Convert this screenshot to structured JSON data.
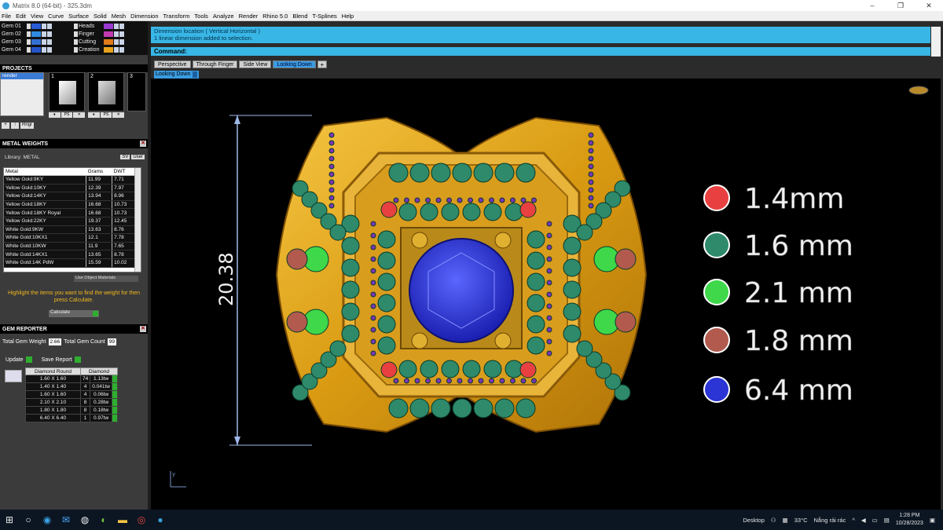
{
  "window": {
    "title": "Matrix 8.0 (64-bit) - 325.3dm",
    "min": "–",
    "max": "❐",
    "close": "✕"
  },
  "menu": [
    "File",
    "Edit",
    "View",
    "Curve",
    "Surface",
    "Solid",
    "Mesh",
    "Dimension",
    "Transform",
    "Tools",
    "Analyze",
    "Render",
    "Rhino 5.0",
    "Blend",
    "T-Splines",
    "Help"
  ],
  "layers": {
    "left": [
      {
        "name": "Gem 01",
        "color": "#2a5bd6"
      },
      {
        "name": "Gem 02",
        "color": "#2f8ae0"
      },
      {
        "name": "Gem 03",
        "color": "#3470d4"
      },
      {
        "name": "Gem 04",
        "color": "#2454c8"
      }
    ],
    "right": [
      {
        "name": "Heads",
        "color": "#9b3ad0"
      },
      {
        "name": "Finger",
        "color": "#c23ab0"
      },
      {
        "name": "Cutting",
        "color": "#e07a1a"
      },
      {
        "name": "Creation",
        "color": "#e8a21c"
      }
    ]
  },
  "projects": {
    "title": "PROJECTS",
    "item": "render",
    "thumbs": [
      "1",
      "2",
      "3"
    ],
    "tool_ring": "Rngr"
  },
  "metal": {
    "title": "METAL WEIGHTS",
    "library": "Library: METAL",
    "btn_sv": "SV",
    "btn_user": "User",
    "headers": [
      "Metal",
      "Grams",
      "DWT"
    ],
    "rows": [
      [
        "Yellow Gold:9KY",
        "11.99",
        "7.71"
      ],
      [
        "Yellow Gold:10KY",
        "12.39",
        "7.97"
      ],
      [
        "Yellow Gold:14KY",
        "13.94",
        "8.96"
      ],
      [
        "Yellow Gold:18KY",
        "16.68",
        "10.73"
      ],
      [
        "Yellow Gold:18KY Royal",
        "16.68",
        "10.73"
      ],
      [
        "Yellow Gold:22KY",
        "19.37",
        "12.45"
      ],
      [
        "White Gold:9KW",
        "13.63",
        "8.76"
      ],
      [
        "White Gold:10KX1",
        "12.1",
        "7.78"
      ],
      [
        "White Gold:10KW",
        "11.9",
        "7.65"
      ],
      [
        "White Gold:14KX1",
        "13.65",
        "8.78"
      ],
      [
        "White Gold:14K PdW",
        "15.59",
        "10.02"
      ]
    ],
    "use_object": "Use Object Materials",
    "hint": "Highlight the items you want to find the weight for then press Calculate.",
    "calculate": "Calculate"
  },
  "gem": {
    "title": "GEM REPORTER",
    "total_weight_label": "Total Gem Weight",
    "total_weight": "2.66",
    "total_count_label": "Total Gem Count",
    "total_count": "99",
    "update": "Update",
    "save_report": "Save Report",
    "headers": [
      "Diamond Round",
      "Diamond"
    ],
    "rows": [
      [
        "1.60 X 1.60",
        "74",
        "1.13tw"
      ],
      [
        "1.40 X 1.40",
        "4",
        "0.041tw"
      ],
      [
        "1.60 X 1.60",
        "4",
        "0.06tw"
      ],
      [
        "2.10 X 2.10",
        "8",
        "0.28tw"
      ],
      [
        "1.80 X 1.80",
        "8",
        "0.18tw"
      ],
      [
        "6.40 X 6.40",
        "1",
        "0.97tw"
      ]
    ]
  },
  "command": {
    "history1": "Dimension location ( Vertical  Horizontal )",
    "history2": "1 linear dimension added to selection.",
    "prompt": "Command:"
  },
  "viewtabs": [
    "Perspective",
    "Through Finger",
    "Side View",
    "Looking Down"
  ],
  "active_tab": "Looking Down",
  "viewport_label": "Looking Down",
  "dimension": "20.38",
  "axis_label": "y",
  "legend": [
    {
      "color": "#e84040",
      "label": "1.4mm"
    },
    {
      "color": "#2e8a6a",
      "label": "1.6 mm"
    },
    {
      "color": "#3ed84a",
      "label": "2.1 mm"
    },
    {
      "color": "#b25a4e",
      "label": "1.8 mm"
    },
    {
      "color": "#2b34d4",
      "label": "6.4 mm"
    }
  ],
  "taskbar": {
    "desktop": "Desktop",
    "temp": "33°C",
    "weather": "Nắng rải rác",
    "time": "1:28 PM",
    "date": "10/28/2023"
  }
}
